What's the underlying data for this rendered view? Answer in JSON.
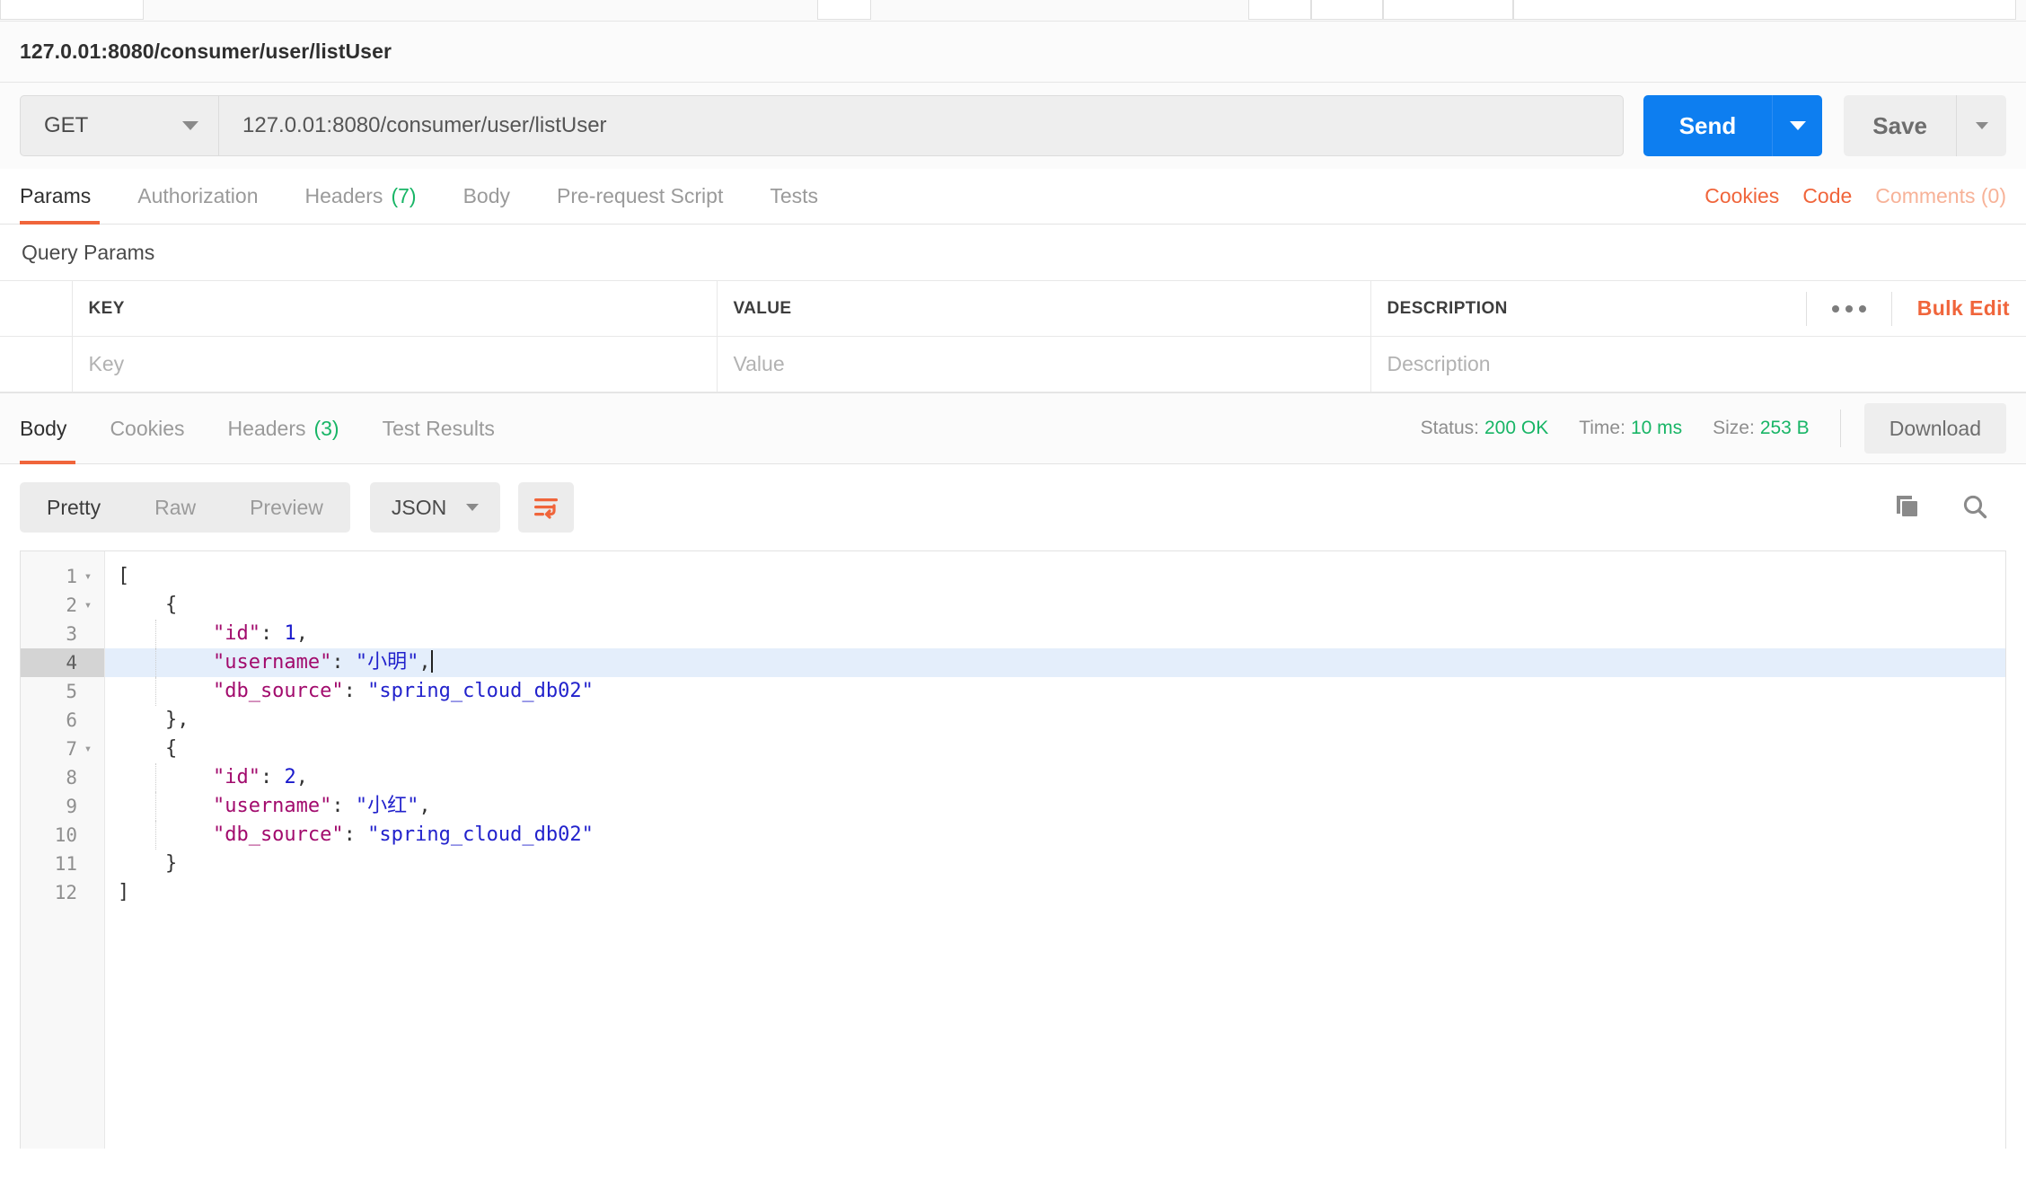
{
  "window": {
    "request_title": "127.0.01:8080/consumer/user/listUser"
  },
  "request_bar": {
    "method": "GET",
    "url": "127.0.01:8080/consumer/user/listUser",
    "send_label": "Send",
    "save_label": "Save"
  },
  "request_tabs": [
    {
      "label": "Params",
      "count": "",
      "active": true
    },
    {
      "label": "Authorization",
      "count": "",
      "active": false
    },
    {
      "label": "Headers",
      "count": "(7)",
      "active": false
    },
    {
      "label": "Body",
      "count": "",
      "active": false
    },
    {
      "label": "Pre-request Script",
      "count": "",
      "active": false
    },
    {
      "label": "Tests",
      "count": "",
      "active": false
    }
  ],
  "request_tab_links": {
    "cookies": "Cookies",
    "code": "Code",
    "comments": "Comments (0)"
  },
  "query_params": {
    "section_title": "Query Params",
    "columns": [
      "KEY",
      "VALUE",
      "DESCRIPTION"
    ],
    "placeholder_row": {
      "key": "Key",
      "value": "Value",
      "description": "Description"
    },
    "bulk_edit_label": "Bulk Edit"
  },
  "response_tabs": [
    {
      "label": "Body",
      "count": "",
      "active": true
    },
    {
      "label": "Cookies",
      "count": "",
      "active": false
    },
    {
      "label": "Headers",
      "count": "(3)",
      "active": false
    },
    {
      "label": "Test Results",
      "count": "",
      "active": false
    }
  ],
  "response_meta": {
    "status_label": "Status:",
    "status_value": "200 OK",
    "time_label": "Time:",
    "time_value": "10 ms",
    "size_label": "Size:",
    "size_value": "253 B",
    "download_label": "Download"
  },
  "body_toolbar": {
    "views": [
      {
        "label": "Pretty",
        "active": true
      },
      {
        "label": "Raw",
        "active": false
      },
      {
        "label": "Preview",
        "active": false
      }
    ],
    "format": "JSON",
    "wrap_icon": "word-wrap-icon",
    "copy_icon": "copy-icon",
    "search_icon": "search-icon"
  },
  "colors": {
    "accent_orange": "#f0653b",
    "send_blue": "#0d7ef0",
    "status_green": "#18b566",
    "json_key": "#a20b6d",
    "json_string": "#2222cc",
    "active_line": "#e4eefb"
  },
  "response_body": {
    "language": "json",
    "active_line": 4,
    "lines": [
      {
        "no": "1",
        "fold": "▾",
        "indent": false,
        "tokens": [
          {
            "t": "p",
            "v": "["
          }
        ]
      },
      {
        "no": "2",
        "fold": "▾",
        "indent": false,
        "tokens": [
          {
            "t": "p",
            "v": "    {"
          }
        ]
      },
      {
        "no": "3",
        "fold": "",
        "indent": true,
        "tokens": [
          {
            "t": "k",
            "v": "        \"id\""
          },
          {
            "t": "p",
            "v": ": "
          },
          {
            "t": "n",
            "v": "1"
          },
          {
            "t": "p",
            "v": ","
          }
        ]
      },
      {
        "no": "4",
        "fold": "",
        "indent": true,
        "tokens": [
          {
            "t": "k",
            "v": "        \"username\""
          },
          {
            "t": "p",
            "v": ": "
          },
          {
            "t": "s",
            "v": "\"小明\""
          },
          {
            "t": "p",
            "v": ","
          },
          {
            "t": "cursor",
            "v": ""
          }
        ]
      },
      {
        "no": "5",
        "fold": "",
        "indent": true,
        "tokens": [
          {
            "t": "k",
            "v": "        \"db_source\""
          },
          {
            "t": "p",
            "v": ": "
          },
          {
            "t": "s",
            "v": "\"spring_cloud_db02\""
          }
        ]
      },
      {
        "no": "6",
        "fold": "",
        "indent": false,
        "tokens": [
          {
            "t": "p",
            "v": "    },"
          }
        ]
      },
      {
        "no": "7",
        "fold": "▾",
        "indent": false,
        "tokens": [
          {
            "t": "p",
            "v": "    {"
          }
        ]
      },
      {
        "no": "8",
        "fold": "",
        "indent": true,
        "tokens": [
          {
            "t": "k",
            "v": "        \"id\""
          },
          {
            "t": "p",
            "v": ": "
          },
          {
            "t": "n",
            "v": "2"
          },
          {
            "t": "p",
            "v": ","
          }
        ]
      },
      {
        "no": "9",
        "fold": "",
        "indent": true,
        "tokens": [
          {
            "t": "k",
            "v": "        \"username\""
          },
          {
            "t": "p",
            "v": ": "
          },
          {
            "t": "s",
            "v": "\"小红\""
          },
          {
            "t": "p",
            "v": ","
          }
        ]
      },
      {
        "no": "10",
        "fold": "",
        "indent": true,
        "tokens": [
          {
            "t": "k",
            "v": "        \"db_source\""
          },
          {
            "t": "p",
            "v": ": "
          },
          {
            "t": "s",
            "v": "\"spring_cloud_db02\""
          }
        ]
      },
      {
        "no": "11",
        "fold": "",
        "indent": false,
        "tokens": [
          {
            "t": "p",
            "v": "    }"
          }
        ]
      },
      {
        "no": "12",
        "fold": "",
        "indent": false,
        "tokens": [
          {
            "t": "p",
            "v": "]"
          }
        ]
      }
    ]
  }
}
